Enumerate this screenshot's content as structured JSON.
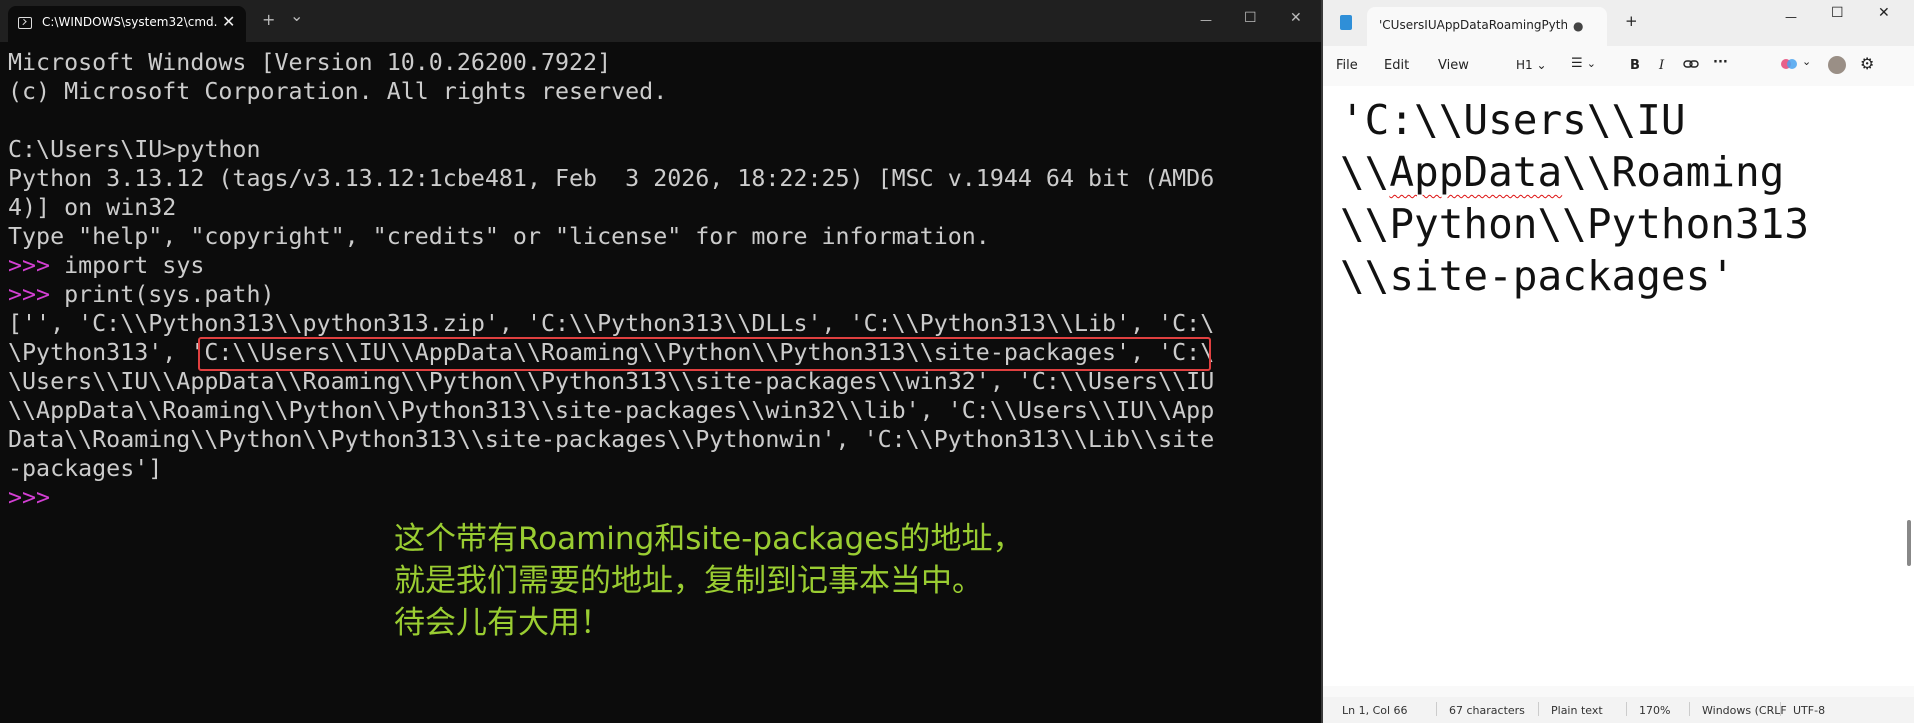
{
  "terminal": {
    "tab_title": "C:\\WINDOWS\\system32\\cmd.",
    "tab_close": "✕",
    "new_tab": "+",
    "dropdown": "⌄",
    "minimize": "—",
    "maximize": "☐",
    "close": "✕",
    "lines": [
      "Microsoft Windows [Version 10.0.26200.7922]",
      "(c) Microsoft Corporation. All rights reserved.",
      "",
      "C:\\Users\\IU>python",
      "Python 3.13.12 (tags/v3.13.12:1cbe481, Feb  3 2026, 18:22:25) [MSC v.1944 64 bit (AMD6",
      "4)] on win32",
      "Type \"help\", \"copyright\", \"credits\" or \"license\" for more information."
    ],
    "prompt": ">>> ",
    "cmd1": "import sys",
    "cmd2": "print(sys.path)",
    "output_lines": [
      "['', 'C:\\\\Python313\\\\python313.zip', 'C:\\\\Python313\\\\DLLs', 'C:\\\\Python313\\\\Lib', 'C:\\",
      "\\Python313', 'C:\\\\Users\\\\IU\\\\AppData\\\\Roaming\\\\Python\\\\Python313\\\\site-packages', 'C:\\",
      "\\Users\\\\IU\\\\AppData\\\\Roaming\\\\Python\\\\Python313\\\\site-packages\\\\win32', 'C:\\\\Users\\\\IU",
      "\\\\AppData\\\\Roaming\\\\Python\\\\Python313\\\\site-packages\\\\win32\\\\lib', 'C:\\\\Users\\\\IU\\\\App",
      "Data\\\\Roaming\\\\Python\\\\Python313\\\\site-packages\\\\Pythonwin', 'C:\\\\Python313\\\\Lib\\\\site",
      "-packages']"
    ],
    "final_prompt": ">>>",
    "annotation": [
      "这个带有Roaming和site-packages的地址，",
      "就是我们需要的地址，复制到记事本当中。",
      "待会儿有大用！"
    ]
  },
  "notepad": {
    "tab_title": "'CUsersIUAppDataRoamingPythonI",
    "tab_dot": "●",
    "new_tab": "+",
    "minimize": "—",
    "maximize": "☐",
    "close": "✕",
    "menu": {
      "file": "File",
      "edit": "Edit",
      "view": "View"
    },
    "toolbar": {
      "heading": "H1",
      "bold": "B",
      "italic": "I",
      "more": "···"
    },
    "text_lines": [
      "'C:\\\\Users\\\\IU",
      "\\\\AppData\\\\Roaming",
      "\\\\Python\\\\Python313",
      "\\\\site-packages'"
    ],
    "text_line2_prefix": "\\\\",
    "text_line2_word": "AppData",
    "text_line2_rest": "\\\\Roaming",
    "status": {
      "position": "Ln 1, Col 66",
      "chars": "67 characters",
      "format": "Plain text",
      "zoom": "170%",
      "eol": "Windows (CRLF",
      "encoding": "UTF-8"
    }
  },
  "colors": {
    "terminal_bg": "#0c0c0c",
    "prompt": "#d33fd3",
    "highlight_box": "#e04040",
    "annotation": "#9acd32"
  }
}
